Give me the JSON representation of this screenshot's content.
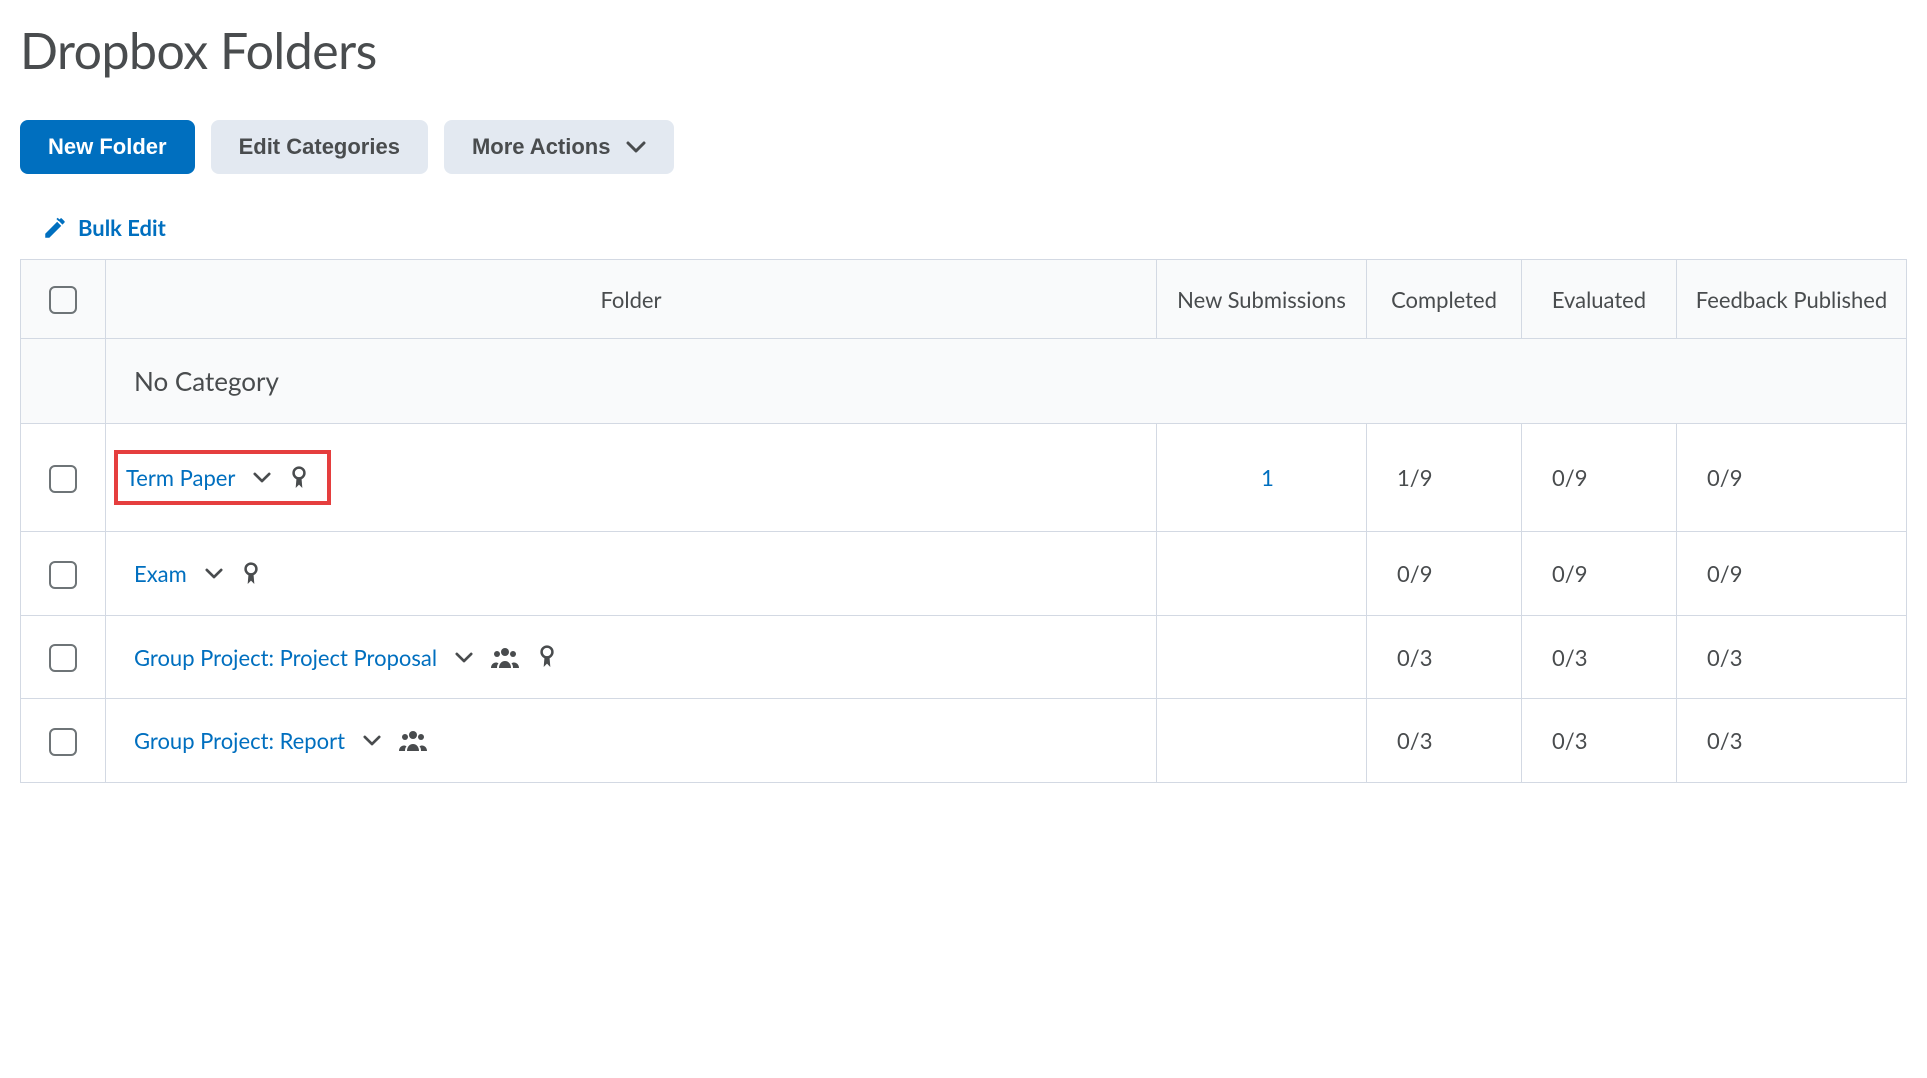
{
  "page": {
    "title": "Dropbox Folders"
  },
  "actions": {
    "new_folder": "New Folder",
    "edit_categories": "Edit Categories",
    "more_actions": "More Actions"
  },
  "bulk_edit": {
    "label": "Bulk Edit"
  },
  "table": {
    "headers": {
      "folder": "Folder",
      "new_submissions": "New Submissions",
      "completed": "Completed",
      "evaluated": "Evaluated",
      "feedback_published": "Feedback Published"
    },
    "category": {
      "name": "No Category"
    },
    "rows": [
      {
        "name": "Term Paper",
        "highlighted": true,
        "has_group": false,
        "has_award": true,
        "new_submissions": "1",
        "completed": "1/9",
        "evaluated": "0/9",
        "feedback_published": "0/9"
      },
      {
        "name": "Exam",
        "highlighted": false,
        "has_group": false,
        "has_award": true,
        "new_submissions": "",
        "completed": "0/9",
        "evaluated": "0/9",
        "feedback_published": "0/9"
      },
      {
        "name": "Group Project: Project Proposal",
        "highlighted": false,
        "has_group": true,
        "has_award": true,
        "new_submissions": "",
        "completed": "0/3",
        "evaluated": "0/3",
        "feedback_published": "0/3"
      },
      {
        "name": "Group Project: Report",
        "highlighted": false,
        "has_group": true,
        "has_award": false,
        "new_submissions": "",
        "completed": "0/3",
        "evaluated": "0/3",
        "feedback_published": "0/3"
      }
    ]
  }
}
